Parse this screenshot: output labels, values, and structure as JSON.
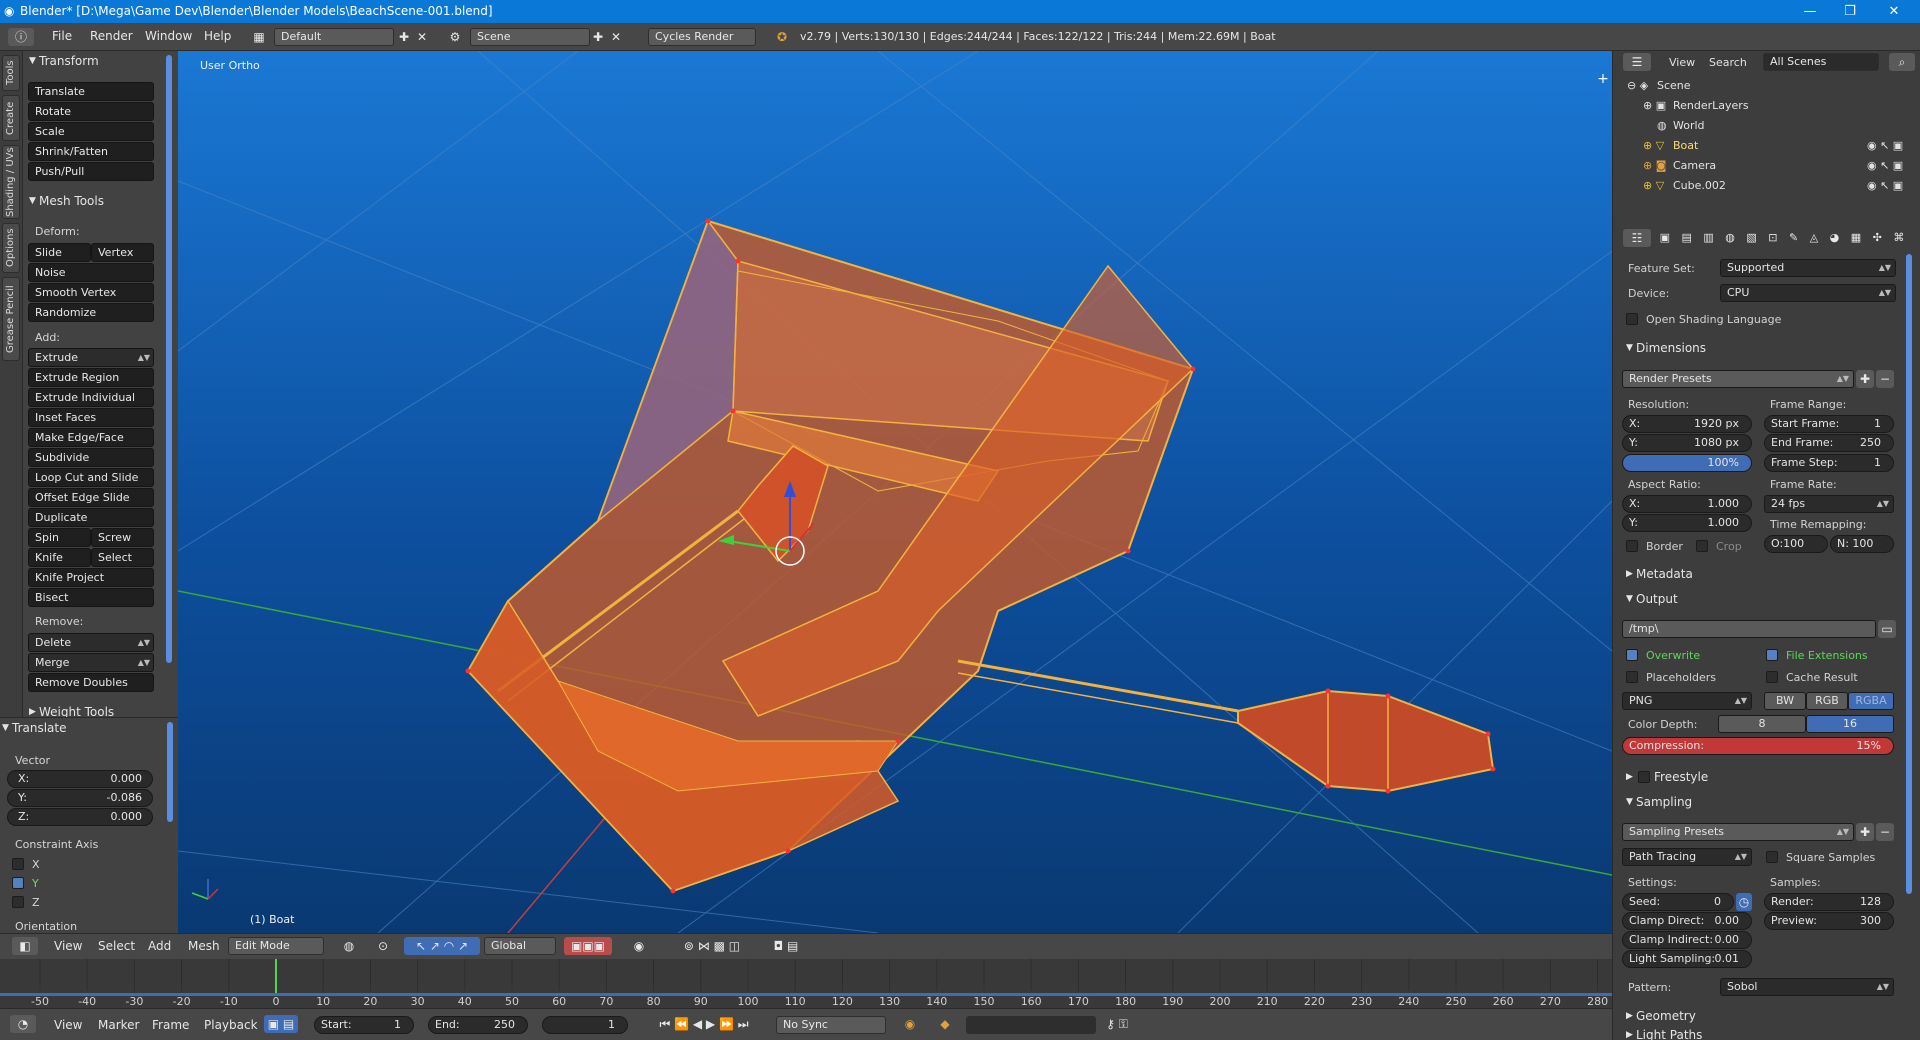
{
  "window": {
    "title": "Blender* [D:\\Mega\\Game Dev\\Blender\\Blender Models\\BeachScene-001.blend]",
    "min": "—",
    "max": "❐",
    "close": "✕"
  },
  "menu": {
    "file": "File",
    "render": "Render",
    "window": "Window",
    "help": "Help",
    "layout": "Default",
    "scene": "Scene",
    "engine": "Cycles Render",
    "stats": "v2.79 | Verts:130/130 | Edges:244/244 | Faces:122/122 | Tris:244 | Mem:22.69M | Boat"
  },
  "tooltabs": [
    "Tools",
    "Create",
    "Shading / UVs",
    "Options",
    "Grease Pencil"
  ],
  "toolshelf": {
    "transform_header": "Transform",
    "transform": [
      "Translate",
      "Rotate",
      "Scale",
      "Shrink/Fatten",
      "Push/Pull"
    ],
    "meshtools_header": "Mesh Tools",
    "deform_label": "Deform:",
    "slide_edge": "Slide Edge",
    "vertex": "Vertex",
    "deform": [
      "Noise",
      "Smooth Vertex",
      "Randomize"
    ],
    "add_label": "Add:",
    "extrude": "Extrude",
    "add": [
      "Extrude Region",
      "Extrude Individual",
      "Inset Faces",
      "Make Edge/Face",
      "Subdivide",
      "Loop Cut and Slide",
      "Offset Edge Slide",
      "Duplicate"
    ],
    "spin": "Spin",
    "screw": "Screw",
    "knife": "Knife",
    "select": "Select",
    "knife_project": "Knife Project",
    "bisect": "Bisect",
    "remove_label": "Remove:",
    "delete": "Delete",
    "merge": "Merge",
    "remove_doubles": "Remove Doubles",
    "weight_tools": "Weight Tools"
  },
  "operator": {
    "header": "Translate",
    "vector_label": "Vector",
    "x_label": "X:",
    "x": "0.000",
    "y_label": "Y:",
    "y": "-0.086",
    "z_label": "Z:",
    "z": "0.000",
    "constraint_label": "Constraint Axis",
    "cx": "X",
    "cy": "Y",
    "cz": "Z",
    "orientation": "Orientation"
  },
  "viewport": {
    "view_name": "User Ortho",
    "object": "(1) Boat"
  },
  "vpheader": {
    "view": "View",
    "select": "Select",
    "add": "Add",
    "mesh": "Mesh",
    "mode": "Edit Mode",
    "orientation": "Global"
  },
  "timeline": {
    "ticks": [
      "-50",
      "-40",
      "-30",
      "-20",
      "-10",
      "0",
      "10",
      "20",
      "30",
      "40",
      "50",
      "60",
      "70",
      "80",
      "90",
      "100",
      "110",
      "120",
      "130",
      "140",
      "150",
      "160",
      "170",
      "180",
      "190",
      "200",
      "210",
      "220",
      "230",
      "240",
      "250",
      "260",
      "270",
      "280"
    ],
    "current_frame": 0
  },
  "tlheader": {
    "view": "View",
    "marker": "Marker",
    "frame": "Frame",
    "playback": "Playback",
    "start_label": "Start:",
    "start": "1",
    "end_label": "End:",
    "end": "250",
    "current": "1",
    "sync": "No Sync"
  },
  "outliner": {
    "view": "View",
    "search": "Search",
    "filter": "All Scenes",
    "scene": "Scene",
    "renderlayers": "RenderLayers",
    "world": "World",
    "boat": "Boat",
    "camera": "Camera",
    "cube": "Cube.002"
  },
  "props": {
    "feature_set_label": "Feature Set:",
    "feature_set": "Supported",
    "device_label": "Device:",
    "device": "CPU",
    "osl": "Open Shading Language",
    "dimensions": "Dimensions",
    "render_presets": "Render Presets",
    "resolution_label": "Resolution:",
    "res_x_label": "X:",
    "res_x": "1920 px",
    "res_y_label": "Y:",
    "res_y": "1080 px",
    "res_pct": "100%",
    "frame_range_label": "Frame Range:",
    "start_frame_label": "Start Frame:",
    "start_frame": "1",
    "end_frame_label": "End Frame:",
    "end_frame": "250",
    "frame_step_label": "Frame Step:",
    "frame_step": "1",
    "aspect_label": "Aspect Ratio:",
    "asp_x_label": "X:",
    "asp_x": "1.000",
    "asp_y_label": "Y:",
    "asp_y": "1.000",
    "frame_rate_label": "Frame Rate:",
    "frame_rate": "24 fps",
    "time_remap_label": "Time Remapping:",
    "remap_old": "O:100",
    "remap_new": "N: 100",
    "border": "Border",
    "crop": "Crop",
    "metadata": "Metadata",
    "output": "Output",
    "path": "/tmp\\",
    "overwrite": "Overwrite",
    "file_ext": "File Extensions",
    "placeholders": "Placeholders",
    "cache_result": "Cache Result",
    "format": "PNG",
    "bw": "BW",
    "rgb": "RGB",
    "rgba": "RGBA",
    "color_depth_label": "Color Depth:",
    "depth8": "8",
    "depth16": "16",
    "compression_label": "Compression:",
    "compression": "15%",
    "freestyle": "Freestyle",
    "sampling": "Sampling",
    "sampling_presets": "Sampling Presets",
    "integrator": "Path Tracing",
    "square_samples": "Square Samples",
    "settings_label": "Settings:",
    "seed_label": "Seed:",
    "seed": "0",
    "clamp_direct_label": "Clamp Direct:",
    "clamp_direct": "0.00",
    "clamp_indirect_label": "Clamp Indirect:",
    "clamp_indirect": "0.00",
    "light_sampling_label": "Light Sampling:",
    "light_sampling": "0.01",
    "samples_label": "Samples:",
    "render_label": "Render:",
    "render": "128",
    "preview_label": "Preview:",
    "preview": "300",
    "pattern_label": "Pattern:",
    "pattern": "Sobol",
    "geometry": "Geometry",
    "light_paths": "Light Paths"
  },
  "colors": {
    "accent": "#5680c2",
    "compression": "#c23838",
    "mesh": "#e0a83a",
    "titlebar": "#0a78d7"
  }
}
